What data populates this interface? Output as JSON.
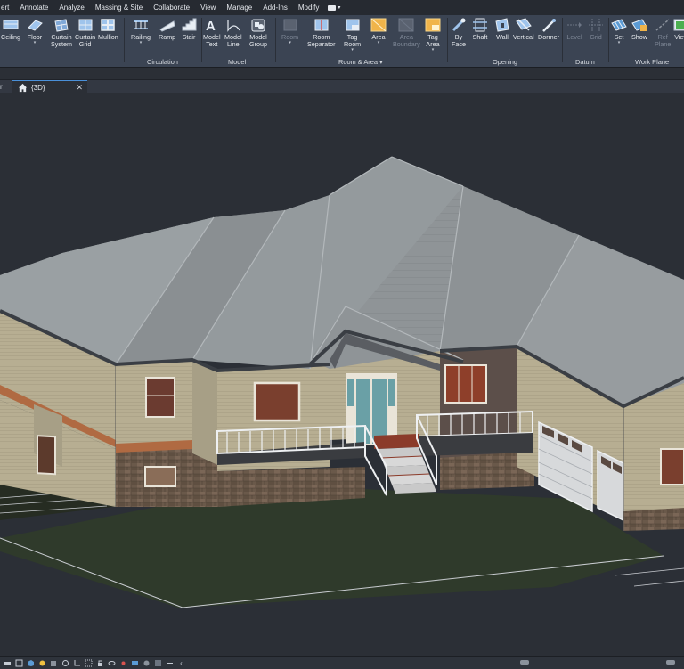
{
  "menu": {
    "items": [
      "ert",
      "Annotate",
      "Analyze",
      "Massing & Site",
      "Collaborate",
      "View",
      "Manage",
      "Add-Ins",
      "Modify"
    ]
  },
  "ribbon": {
    "tools": {
      "ceiling": "Ceiling",
      "floor": "Floor",
      "curtain_system": [
        "Curtain",
        "System"
      ],
      "curtain_grid": [
        "Curtain",
        "Grid"
      ],
      "mullion": "Mullion",
      "railing": "Railing",
      "ramp": "Ramp",
      "stair": "Stair",
      "model_text": [
        "Model",
        "Text"
      ],
      "model_line": [
        "Model",
        "Line"
      ],
      "model_group": [
        "Model",
        "Group"
      ],
      "room": "Room",
      "room_separator": [
        "Room",
        "Separator"
      ],
      "tag_room": [
        "Tag",
        "Room"
      ],
      "area": "Area",
      "area_boundary": [
        "Area",
        "Boundary"
      ],
      "tag_area": [
        "Tag",
        "Area"
      ],
      "by_face": [
        "By",
        "Face"
      ],
      "shaft": "Shaft",
      "wall": "Wall",
      "vertical": "Vertical",
      "dormer": "Dormer",
      "level": "Level",
      "grid": "Grid",
      "set": "Set",
      "show": "Show",
      "ref_plane": [
        "Ref",
        "Plane"
      ],
      "viewer": "View"
    },
    "panels": {
      "circulation": "Circulation",
      "model": "Model",
      "room_area": "Room & Area",
      "opening": "Opening",
      "datum": "Datum",
      "work_plane": "Work Plane"
    }
  },
  "tabs": {
    "ghost": "r",
    "active": "{3D}"
  },
  "colors": {
    "ribbon_bg": "#3b4453",
    "viewport_bg": "#2b2f36",
    "roof": "#8f9497",
    "siding": "#b9b094",
    "stone": "#6e5c4c",
    "trim": "#c06a3c"
  }
}
